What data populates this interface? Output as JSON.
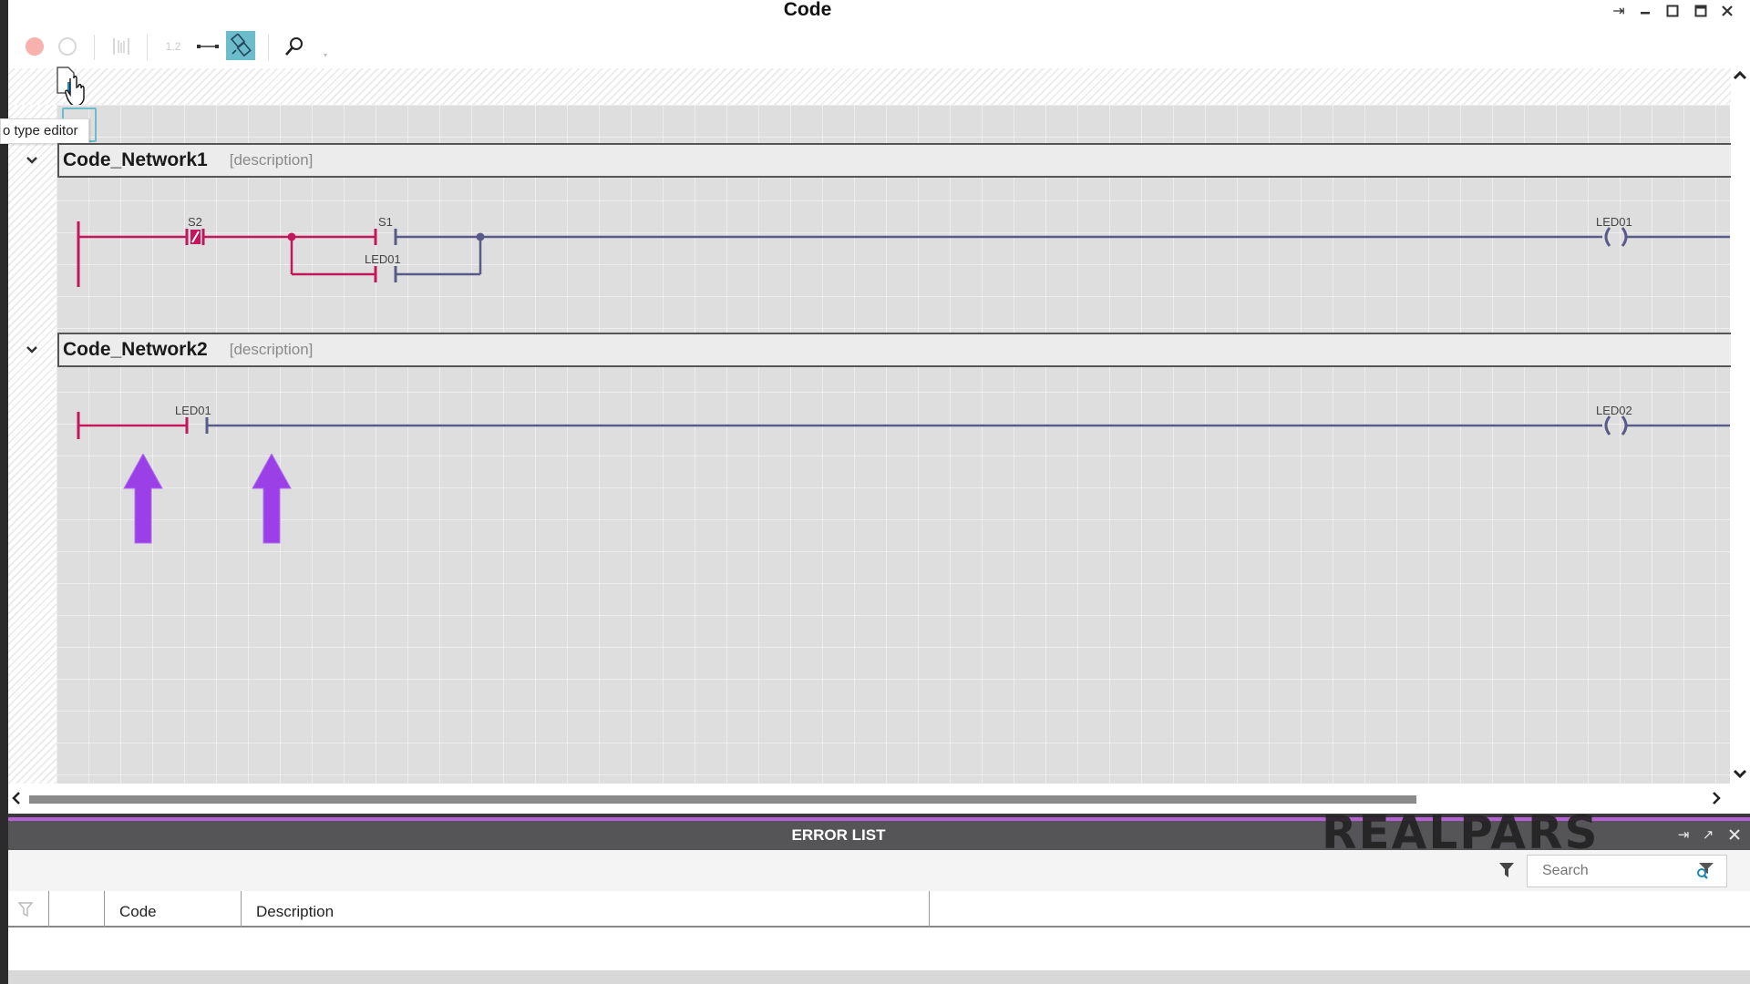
{
  "window": {
    "title": "Code",
    "controls": [
      "pin",
      "minimize",
      "restore",
      "maximize",
      "close"
    ]
  },
  "toolbar": {
    "items": [
      {
        "name": "record-button",
        "icon": "red-circle-icon",
        "disabled": true
      },
      {
        "name": "stop-button",
        "icon": "circle-icon",
        "disabled": true
      },
      {
        "name": "align-button",
        "icon": "align-icon",
        "disabled": true
      },
      {
        "name": "numbering-button",
        "icon": "numbering-icon",
        "label": "1.2",
        "disabled": true
      },
      {
        "name": "connect-button",
        "icon": "connector-icon"
      },
      {
        "name": "auto-route-button",
        "icon": "link-edit-icon",
        "active": true
      },
      {
        "name": "zoom-button",
        "icon": "magnifier-icon"
      }
    ]
  },
  "tooltip": "o type editor",
  "networks": [
    {
      "title": "Code_Network1",
      "description": "[description]",
      "elements": [
        {
          "type": "contact-nc",
          "tag": "S2"
        },
        {
          "type": "contact-no",
          "tag": "S1"
        },
        {
          "type": "contact-no",
          "tag": "LED01",
          "branch": "parallel"
        },
        {
          "type": "coil",
          "tag": "LED01"
        }
      ]
    },
    {
      "title": "Code_Network2",
      "description": "[description]",
      "elements": [
        {
          "type": "contact-no",
          "tag": "LED01"
        },
        {
          "type": "coil",
          "tag": "LED02"
        }
      ]
    }
  ],
  "colors": {
    "energized": "#c2185b",
    "de_energized": "#5a5a8a",
    "annotation_arrow": "#9b3fe6",
    "accent": "#6cbccc",
    "panel_purple": "#b65fd6"
  },
  "error_list": {
    "title": "ERROR LIST",
    "search_placeholder": "Search",
    "columns": [
      "",
      "",
      "Code",
      "Description",
      ""
    ],
    "rows": []
  },
  "watermark": "REALPARS"
}
